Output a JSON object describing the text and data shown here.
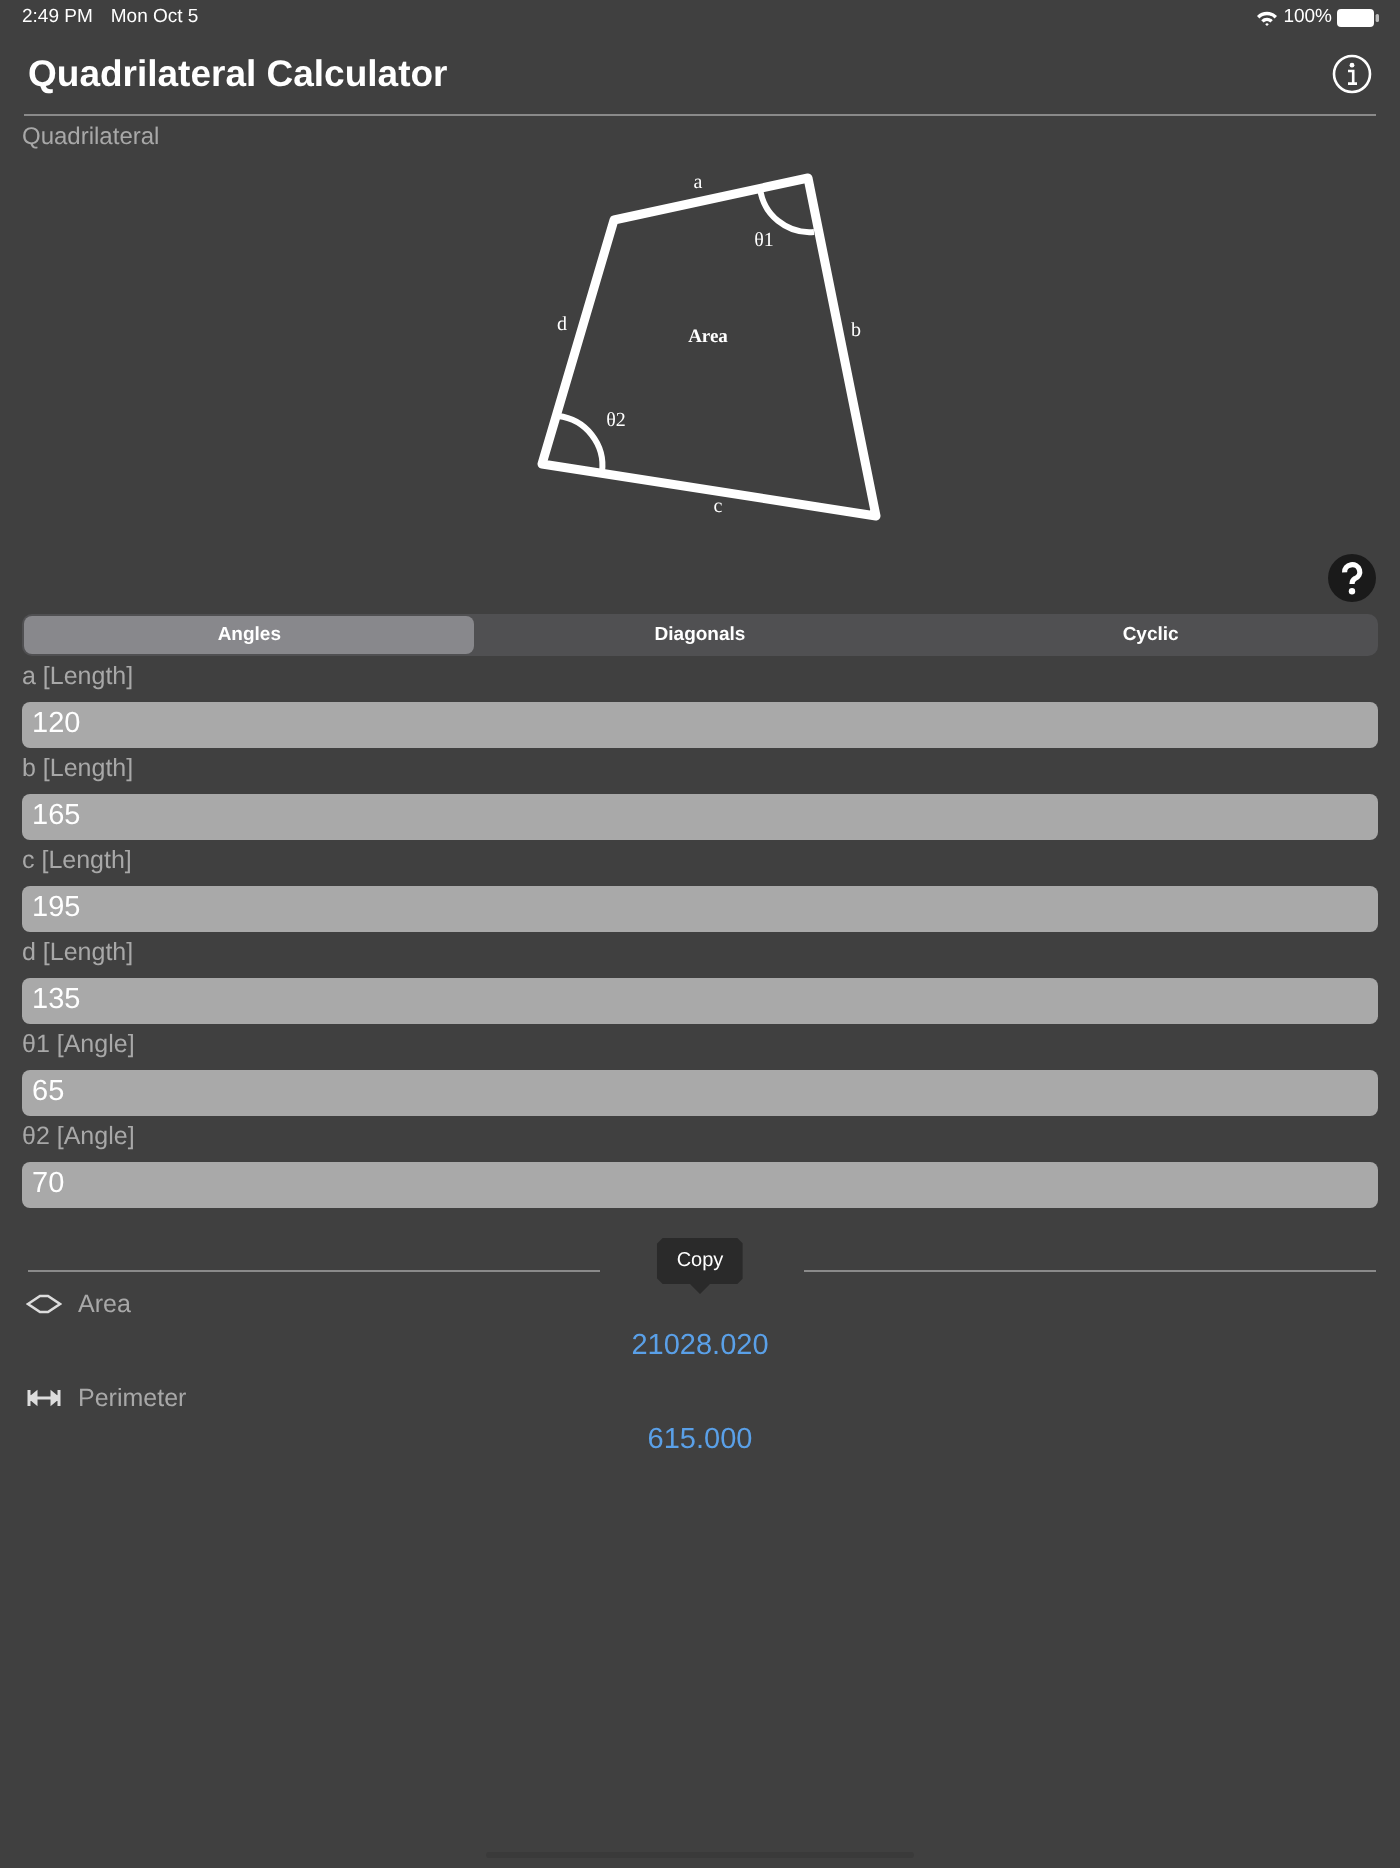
{
  "status_bar": {
    "time": "2:49 PM",
    "date": "Mon Oct 5",
    "battery": "100%"
  },
  "nav": {
    "title": "Quadrilateral Calculator"
  },
  "section": "Quadrilateral",
  "diagram": {
    "labels": {
      "a": "a",
      "b": "b",
      "c": "c",
      "d": "d",
      "theta1": "θ1",
      "theta2": "θ2",
      "area": "Area"
    }
  },
  "tabs": [
    {
      "label": "Angles",
      "selected": true
    },
    {
      "label": "Diagonals",
      "selected": false
    },
    {
      "label": "Cyclic",
      "selected": false
    }
  ],
  "inputs": [
    {
      "label": "a [Length]",
      "value": "120"
    },
    {
      "label": "b [Length]",
      "value": "165"
    },
    {
      "label": "c [Length]",
      "value": "195"
    },
    {
      "label": "d [Length]",
      "value": "135"
    },
    {
      "label": "θ1 [Angle]",
      "value": "65"
    },
    {
      "label": "θ2 [Angle]",
      "value": "70"
    }
  ],
  "tooltip": "Copy",
  "results": [
    {
      "kind": "area",
      "label": "Area",
      "value": "21028.020"
    },
    {
      "kind": "perimeter",
      "label": "Perimeter",
      "value": "615.000"
    }
  ]
}
